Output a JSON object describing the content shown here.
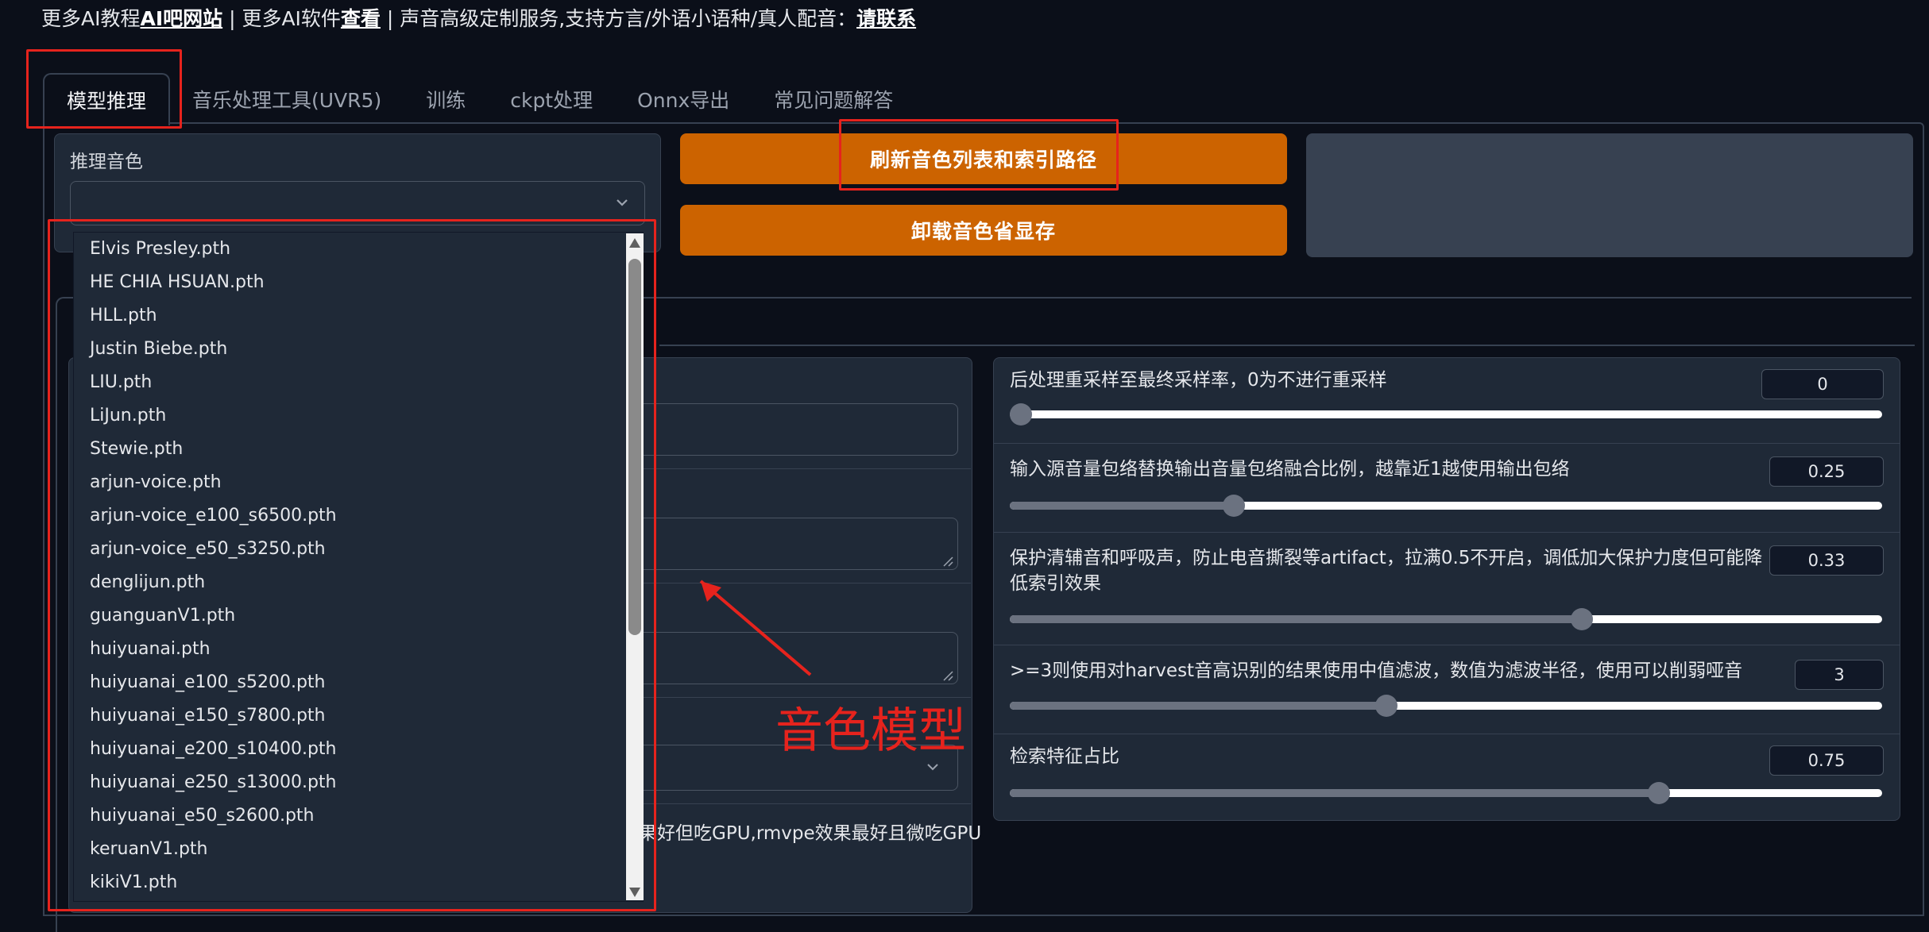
{
  "banner": {
    "prefix": "更多AI教程",
    "link1": "AI吧网站",
    "mid": " | 更多AI软件",
    "link2": "查看",
    "suffix": " | 声音高级定制服务,支持方言/外语小语种/真人配音：",
    "link3": "请联系"
  },
  "tabs": [
    {
      "label": "模型推理",
      "active": true
    },
    {
      "label": "音乐处理工具(UVR5)"
    },
    {
      "label": "训练"
    },
    {
      "label": "ckpt处理"
    },
    {
      "label": "Onnx导出"
    },
    {
      "label": "常见问题解答"
    }
  ],
  "voice": {
    "label": "推理音色",
    "value": ""
  },
  "buttons": {
    "refresh": "刷新音色列表和索引路径",
    "unload": "卸载音色省显存"
  },
  "dropdown_options": [
    "Elvis Presley.pth",
    "HE CHIA HSUAN.pth",
    "HLL.pth",
    "Justin Biebe.pth",
    "LIU.pth",
    "LiJun.pth",
    "Stewie.pth",
    "arjun-voice.pth",
    "arjun-voice_e100_s6500.pth",
    "arjun-voice_e50_s3250.pth",
    "denglijun.pth",
    "guanguanV1.pth",
    "huiyuanai.pth",
    "huiyuanai_e100_s5200.pth",
    "huiyuanai_e150_s7800.pth",
    "huiyuanai_e200_s10400.pth",
    "huiyuanai_e250_s13000.pth",
    "huiyuanai_e50_s2600.pth",
    "keruanV1.pth",
    "kikiV1.pth"
  ],
  "f0_tail": "果好但吃GPU,rmvpe效果最好且微吃GPU",
  "sliders": [
    {
      "label": "后处理重采样至最终采样率，0为不进行重采样",
      "value": "0",
      "fraction": 0.0
    },
    {
      "label": "输入源音量包络替换输出音量包络融合比例，越靠近1越使用输出包络",
      "value": "0.25",
      "fraction": 0.25
    },
    {
      "label": "保护清辅音和呼吸声，防止电音撕裂等artifact，拉满0.5不开启，调低加大保护力度但可能降低索引效果",
      "value": "0.33",
      "fraction": 0.66
    },
    {
      "label": ">=3则使用对harvest音高识别的结果使用中值滤波，数值为滤波半径，使用可以削弱哑音",
      "value": "3",
      "fraction": 0.43
    },
    {
      "label": "检索特征占比",
      "value": "0.75",
      "fraction": 0.75
    }
  ],
  "annotation": {
    "text": "音色模型",
    "color": "#e6231d"
  },
  "colors": {
    "accent": "#cc6300",
    "background": "#0b0f19",
    "panel": "#1f2937"
  }
}
